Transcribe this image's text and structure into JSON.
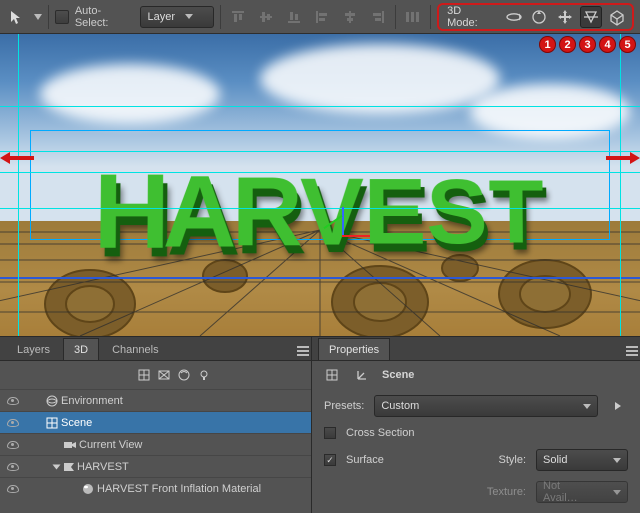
{
  "optionBar": {
    "autoSelectLabel": "Auto-Select:",
    "layerDropdown": "Layer",
    "modeLabel": "3D Mode:"
  },
  "badges": [
    "1",
    "2",
    "3",
    "4",
    "5"
  ],
  "scene3dText": "HARVEST",
  "panelLeft": {
    "tabs": [
      "Layers",
      "3D",
      "Channels"
    ],
    "activeTab": 1,
    "tree": [
      {
        "label": "Environment",
        "indent": 0,
        "selected": false,
        "icon": "env",
        "expand": false
      },
      {
        "label": "Scene",
        "indent": 0,
        "selected": true,
        "icon": "scene",
        "expand": false
      },
      {
        "label": "Current View",
        "indent": 1,
        "selected": false,
        "icon": "camera",
        "expand": false
      },
      {
        "label": "HARVEST",
        "indent": 1,
        "selected": false,
        "icon": "mesh",
        "expand": true
      },
      {
        "label": "HARVEST Front Inflation Material",
        "indent": 2,
        "selected": false,
        "icon": "material",
        "expand": false
      }
    ]
  },
  "panelRight": {
    "title": "Properties",
    "sceneLabel": "Scene",
    "presetsLabel": "Presets:",
    "presetsValue": "Custom",
    "crossSectionLabel": "Cross Section",
    "surfaceLabel": "Surface",
    "surfaceChecked": true,
    "styleLabel": "Style:",
    "styleValue": "Solid",
    "textureLabel": "Texture:",
    "textureValue": "Not Avail…"
  }
}
